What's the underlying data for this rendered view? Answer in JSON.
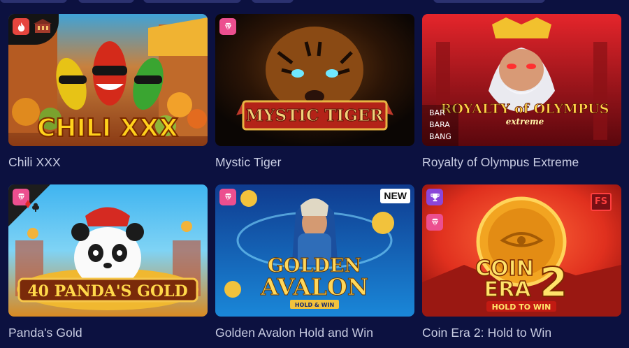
{
  "colors": {
    "background": "#0c1140",
    "title_text": "#c9cde3",
    "badge_pink": "#ec4f8f",
    "badge_purple": "#8b46d9",
    "badge_red": "#e5453e"
  },
  "games": [
    {
      "title": "Chili XXX",
      "logo_text": "CHILI XXX",
      "badges": [
        "fire-icon",
        "building-icon"
      ]
    },
    {
      "title": "Mystic Tiger",
      "logo_text": "MYSTIC TIGER",
      "badges": [
        "diamond-icon"
      ]
    },
    {
      "title": "Royalty of Olympus Extreme",
      "logo_text": "ROYALTY of OLYMPUS",
      "logo_subtext": "extreme",
      "provider_text": [
        "BAR",
        "BARA",
        "BANG"
      ]
    },
    {
      "title": "Panda's Gold",
      "logo_text": "40 PANDA'S GOLD",
      "badges": [
        "diamond-icon",
        "card-suits-icon"
      ]
    },
    {
      "title": "Golden Avalon Hold and Win",
      "logo_text": [
        "GOLDEN",
        "AVALON"
      ],
      "logo_subtext": "HOLD & WIN",
      "new_label": "NEW",
      "badges": [
        "diamond-icon"
      ]
    },
    {
      "title": "Coin Era 2: Hold to Win",
      "logo_text": [
        "COIN",
        "ERA",
        "2"
      ],
      "logo_subtext": "HOLD TO WIN",
      "fs_label": "FS",
      "badges": [
        "trophy-icon",
        "diamond-icon"
      ]
    }
  ]
}
